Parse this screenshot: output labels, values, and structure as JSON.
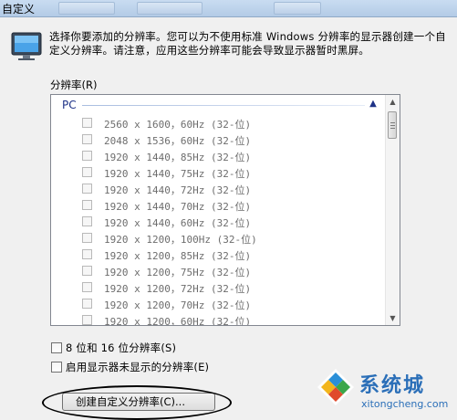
{
  "window": {
    "title": "自定义"
  },
  "description": "选择你要添加的分辨率。您可以为不使用标准 Windows 分辨率的显示器创建一个自定义分辨率。请注意，应用这些分辨率可能会导致显示器暂时黑屏。",
  "resolutions_label": "分辨率(R)",
  "group": {
    "name": "PC"
  },
  "resolutions": [
    "2560 x 1600，60Hz (32-位)",
    "2048 x 1536，60Hz (32-位)",
    "1920 x 1440，85Hz (32-位)",
    "1920 x 1440，75Hz (32-位)",
    "1920 x 1440，72Hz (32-位)",
    "1920 x 1440，70Hz (32-位)",
    "1920 x 1440，60Hz (32-位)",
    "1920 x 1200，100Hz (32-位)",
    "1920 x 1200，85Hz (32-位)",
    "1920 x 1200，75Hz (32-位)",
    "1920 x 1200，72Hz (32-位)",
    "1920 x 1200，70Hz (32-位)",
    "1920 x 1200，60Hz (32-位)"
  ],
  "options": {
    "bit_depth": "8 位和 16 位分辨率(S)",
    "unsupported": "启用显示器未显示的分辨率(E)"
  },
  "create_button": "创建自定义分辨率(C)...",
  "watermark": {
    "name": "系统城",
    "url": "xitongcheng.com"
  },
  "colors": {
    "accent": "#1e3287",
    "watermark": "#2b6fb8"
  }
}
